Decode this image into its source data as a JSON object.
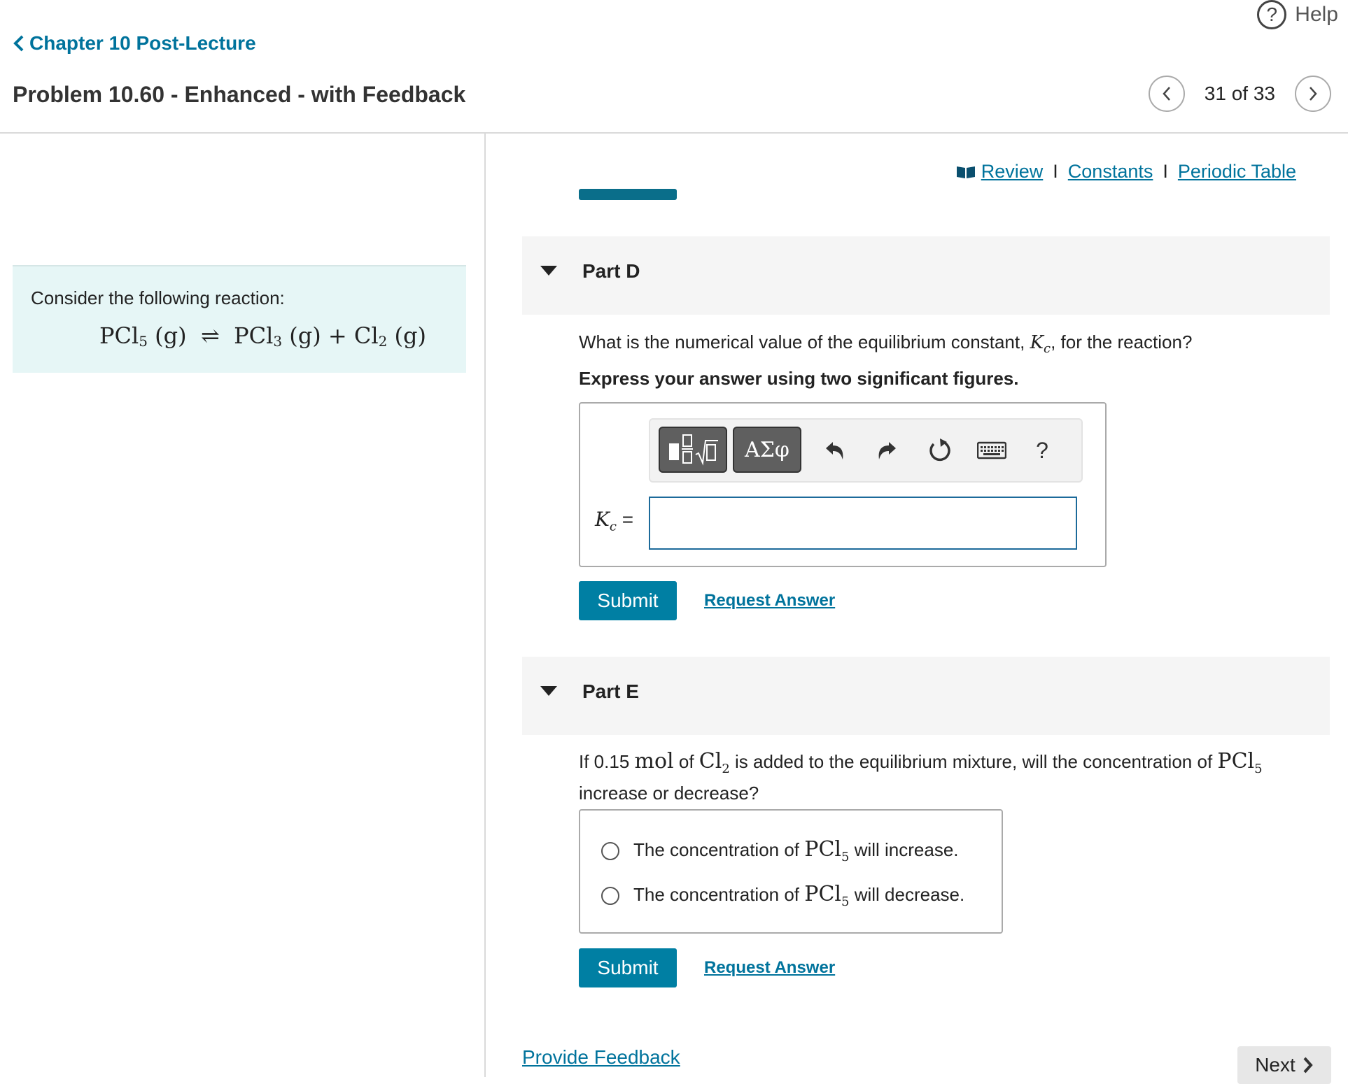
{
  "header": {
    "help_label": "Help",
    "back_label": "Chapter 10 Post-Lecture",
    "title": "Problem 10.60 - Enhanced - with Feedback",
    "pager_text": "31 of 33"
  },
  "links": {
    "review": "Review",
    "constants": "Constants",
    "periodic_table": "Periodic Table",
    "separator": "I"
  },
  "reaction": {
    "prompt": "Consider the following reaction:",
    "equation": {
      "lhs_base": "PCl",
      "lhs_sub": "5",
      "lhs_state": "(g)",
      "arrow": "⇌",
      "rhs1_base": "PCl",
      "rhs1_sub": "3",
      "rhs1_state": "(g)",
      "plus": "+",
      "rhs2_base": "Cl",
      "rhs2_sub": "2",
      "rhs2_state": "(g)"
    }
  },
  "part_d": {
    "label": "Part D",
    "question_pre": "What is the numerical value of the equilibrium constant,",
    "kc_symbol": "K",
    "kc_sub": "c",
    "question_post": ", for the reaction?",
    "instruction": "Express your answer using two significant figures.",
    "toolbar": {
      "templates_icon": "fraction-sqrt-templates-icon",
      "symbols_label": "ΑΣφ",
      "help_label": "?"
    },
    "input_label": "=",
    "input_value": "",
    "submit_label": "Submit",
    "request_answer_label": "Request Answer"
  },
  "part_e": {
    "label": "Part E",
    "q_prefix": "If 0.15",
    "q_unit": "mol",
    "q_mid1": "of",
    "q_species": "Cl",
    "q_species_sub": "2",
    "q_mid2": "is added to the equilibrium mixture, will the concentration of",
    "q_target": "PCl",
    "q_target_sub": "5",
    "q_end": "increase or decrease?",
    "options": [
      {
        "pre": "The concentration of",
        "species": "PCl",
        "sub": "5",
        "post": "will increase."
      },
      {
        "pre": "The concentration of",
        "species": "PCl",
        "sub": "5",
        "post": "will decrease."
      }
    ],
    "submit_label": "Submit",
    "request_answer_label": "Request Answer"
  },
  "footer": {
    "feedback_label": "Provide Feedback",
    "next_label": "Next"
  },
  "colors": {
    "accent": "#007fa3",
    "link": "#00739c",
    "reaction_bg": "#e6f6f6"
  }
}
